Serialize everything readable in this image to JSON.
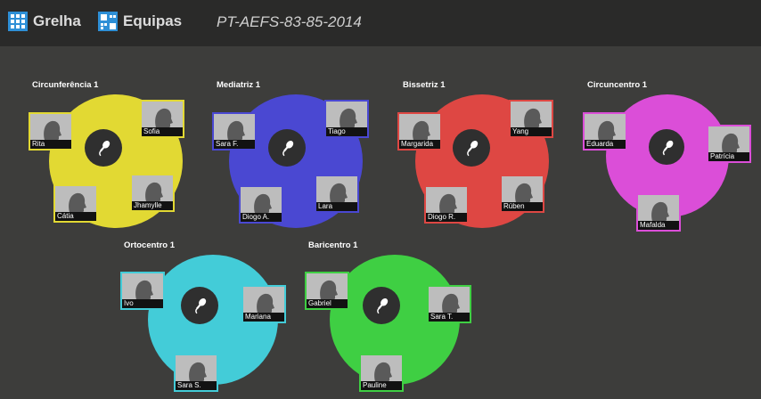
{
  "nav": {
    "grid_label": "Grelha",
    "teams_label": "Equipas",
    "session_code": "PT-AEFS-83-85-2014"
  },
  "groups": [
    {
      "title": "Circunferência 1",
      "color": "#e2d933",
      "members": [
        "Rita",
        "Sofia",
        "Cátia",
        "Jhamylle"
      ]
    },
    {
      "title": "Mediatriz 1",
      "color": "#4a48d2",
      "members": [
        "Sara F.",
        "Tiago",
        "Diogo A.",
        "Lara"
      ]
    },
    {
      "title": "Bissetriz 1",
      "color": "#de4743",
      "members": [
        "Margarida",
        "Yang",
        "Diogo R.",
        "Rúben"
      ]
    },
    {
      "title": "Circuncentro 1",
      "color": "#db4ed8",
      "members": [
        "Eduarda",
        "Patrícia",
        "Mafalda"
      ]
    },
    {
      "title": "Ortocentro 1",
      "color": "#43ccd8",
      "members": [
        "Ivo",
        "Mariana",
        "Sara S."
      ]
    },
    {
      "title": "Baricentro 1",
      "color": "#3fcf43",
      "members": [
        "Gabriel",
        "Sara T.",
        "Pauline"
      ]
    }
  ],
  "icons": {
    "grid": "grid-icon",
    "teams": "teams-icon",
    "mic": "microphone-icon",
    "avatar": "avatar-silhouette-icon"
  }
}
